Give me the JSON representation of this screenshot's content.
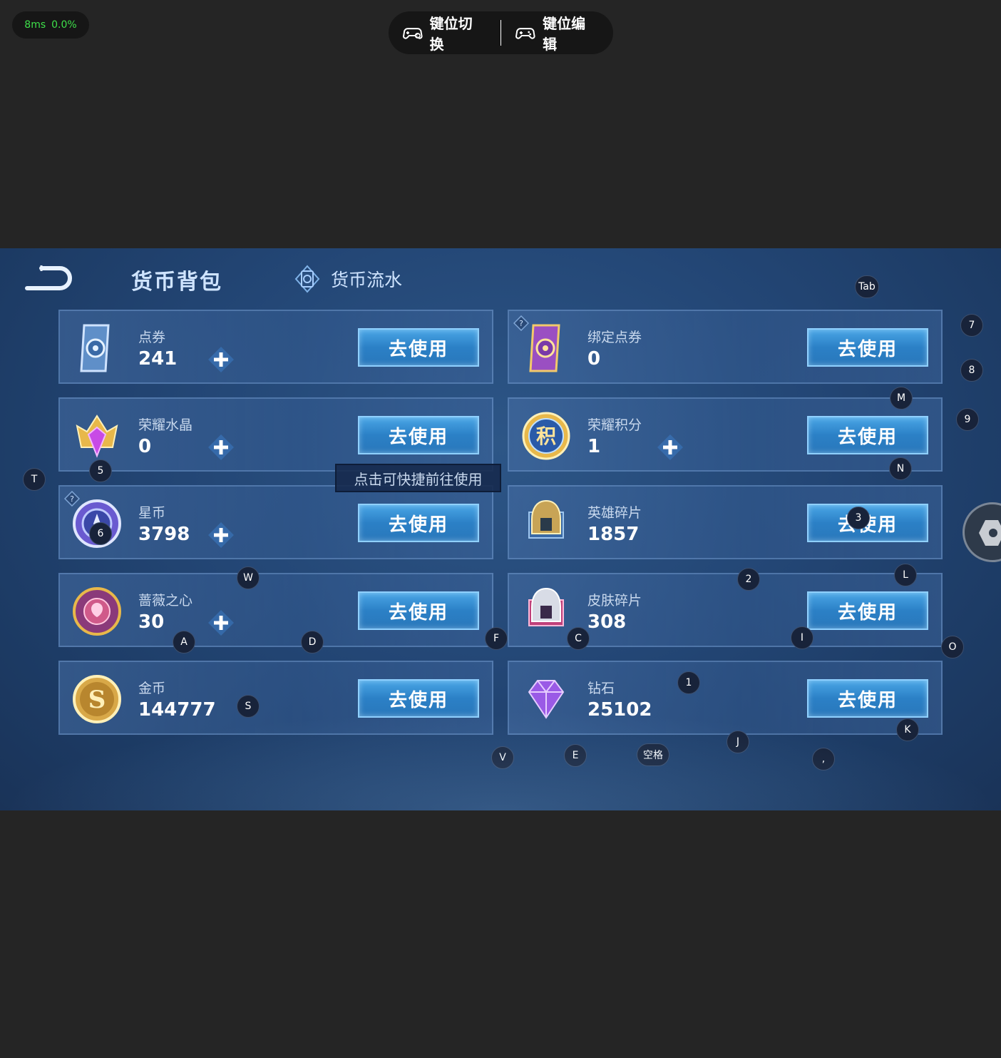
{
  "stats": {
    "latency": "8ms",
    "loss": "0.0%"
  },
  "toolbar": {
    "switch_label": "键位切换",
    "edit_label": "键位编辑"
  },
  "header": {
    "tab_active": "货币背包",
    "tab_flow": "货币流水"
  },
  "cards": [
    {
      "name": "点券",
      "value": "241",
      "button": "去使用"
    },
    {
      "name": "绑定点券",
      "value": "0",
      "button": "去使用"
    },
    {
      "name": "荣耀水晶",
      "value": "0",
      "button": "去使用"
    },
    {
      "name": "荣耀积分",
      "value": "1",
      "button": "去使用"
    },
    {
      "name": "星币",
      "value": "3798",
      "button": "去使用"
    },
    {
      "name": "英雄碎片",
      "value": "1857",
      "button": "去使用"
    },
    {
      "name": "蔷薇之心",
      "value": "30",
      "button": "去使用"
    },
    {
      "name": "皮肤碎片",
      "value": "308",
      "button": "去使用"
    },
    {
      "name": "金币",
      "value": "144777",
      "button": "去使用"
    },
    {
      "name": "钻石",
      "value": "25102",
      "button": "去使用"
    }
  ],
  "tooltip": "点击可快捷前往使用",
  "icon_glyphs": {
    "glory_points": "积"
  },
  "keys": {
    "tab": "Tab",
    "k7": "7",
    "k8": "8",
    "k9": "9",
    "m": "M",
    "n": "N",
    "t": "T",
    "k5": "5",
    "k6": "6",
    "k3": "3",
    "w": "W",
    "k2": "2",
    "l": "L",
    "a": "A",
    "d": "D",
    "f": "F",
    "c": "C",
    "i": "I",
    "o": "O",
    "k1": "1",
    "s": "S",
    "k": "K",
    "j": "J",
    "v": "V",
    "e": "E",
    "space": "空格",
    "comma": ","
  }
}
